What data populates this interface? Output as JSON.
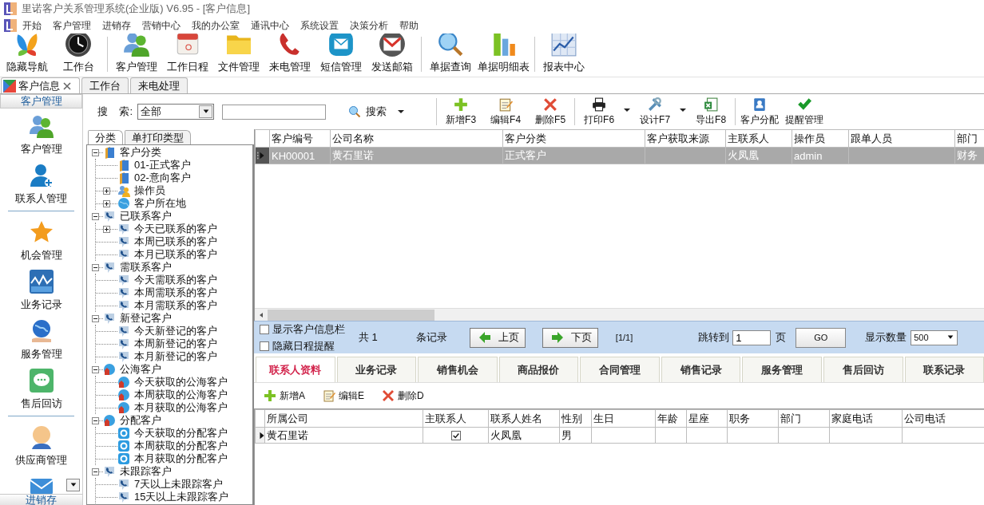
{
  "window": {
    "title": "里诺客户关系管理系统(企业版) V6.95 - [客户信息]"
  },
  "menu": [
    "开始",
    "客户管理",
    "进销存",
    "营销中心",
    "我的办公室",
    "通讯中心",
    "系统设置",
    "决策分析",
    "帮助"
  ],
  "toolbar": [
    [
      "隐藏导航",
      "工作台"
    ],
    [
      "客户管理",
      "工作日程",
      "文件管理",
      "来电管理",
      "短信管理",
      "发送邮箱"
    ],
    [
      "单据查询",
      "单据明细表"
    ],
    [
      "报表中心"
    ]
  ],
  "doc_tabs": [
    {
      "label": "客户信息",
      "selected": true,
      "closable": true
    },
    {
      "label": "工作台",
      "selected": false,
      "closable": false
    },
    {
      "label": "来电处理",
      "selected": false,
      "closable": false
    }
  ],
  "nav": {
    "header": "客户管理",
    "groups": [
      [
        "客户管理",
        "联系人管理"
      ],
      [
        "机会管理",
        "业务记录",
        "服务管理",
        "售后回访"
      ],
      [
        "供应商管理"
      ]
    ],
    "footer": "进销存"
  },
  "search": {
    "label": "搜    索:",
    "scope": "全部",
    "button": "搜索"
  },
  "actions": [
    [
      {
        "label": "新增F3",
        "dropdown": false
      },
      {
        "label": "编辑F4",
        "dropdown": false
      },
      {
        "label": "删除F5",
        "dropdown": false
      }
    ],
    [
      {
        "label": "打印F6",
        "dropdown": true
      },
      {
        "label": "设计F7",
        "dropdown": true
      },
      {
        "label": "导出F8",
        "dropdown": false
      }
    ],
    [
      {
        "label": "客户分配",
        "dropdown": false
      },
      {
        "label": "提醒管理",
        "dropdown": false
      }
    ]
  ],
  "tree_tabs": [
    {
      "label": "分类",
      "selected": true
    },
    {
      "label": "单打印类型",
      "selected": false
    }
  ],
  "tree": [
    {
      "label": "客户分类",
      "kind": "book",
      "expanded": true,
      "children": [
        {
          "label": "01-正式客户",
          "kind": "book"
        },
        {
          "label": "02-意向客户",
          "kind": "book"
        },
        {
          "label": "操作员",
          "kind": "users",
          "expanded": false
        },
        {
          "label": "客户所在地",
          "kind": "globe",
          "expanded": false
        }
      ]
    },
    {
      "label": "已联系客户",
      "kind": "phone",
      "expanded": true,
      "children": [
        {
          "label": "今天已联系的客户",
          "kind": "phone",
          "expanded": false
        },
        {
          "label": "本周已联系的客户",
          "kind": "phone"
        },
        {
          "label": "本月已联系的客户",
          "kind": "phone"
        }
      ]
    },
    {
      "label": "需联系客户",
      "kind": "phone",
      "expanded": true,
      "children": [
        {
          "label": "今天需联系的客户",
          "kind": "phone"
        },
        {
          "label": "本周需联系的客户",
          "kind": "phone"
        },
        {
          "label": "本月需联系的客户",
          "kind": "phone"
        }
      ]
    },
    {
      "label": "新登记客户",
      "kind": "phone",
      "expanded": true,
      "children": [
        {
          "label": "今天新登记的客户",
          "kind": "phone"
        },
        {
          "label": "本周新登记的客户",
          "kind": "phone"
        },
        {
          "label": "本月新登记的客户",
          "kind": "phone"
        }
      ]
    },
    {
      "label": "公海客户",
      "kind": "sea",
      "expanded": true,
      "children": [
        {
          "label": "今天获取的公海客户",
          "kind": "sea"
        },
        {
          "label": "本周获取的公海客户",
          "kind": "sea"
        },
        {
          "label": "本月获取的公海客户",
          "kind": "sea"
        }
      ]
    },
    {
      "label": "分配客户",
      "kind": "sea",
      "expanded": true,
      "children": [
        {
          "label": "今天获取的分配客户",
          "kind": "badge"
        },
        {
          "label": "本周获取的分配客户",
          "kind": "badge"
        },
        {
          "label": "本月获取的分配客户",
          "kind": "badge"
        }
      ]
    },
    {
      "label": "未跟踪客户",
      "kind": "phone",
      "expanded": true,
      "children": [
        {
          "label": "7天以上未跟踪客户",
          "kind": "phone"
        },
        {
          "label": "15天以上未跟踪客户",
          "kind": "phone"
        }
      ]
    }
  ],
  "grid": {
    "columns": [
      "客户编号",
      "公司名称",
      "客户分类",
      "客户获取来源",
      "主联系人",
      "操作员",
      "跟单人员",
      "部门"
    ],
    "rows": [
      {
        "selected": true,
        "cells": [
          "KH00001",
          "黄石里诺",
          "正式客户",
          null,
          "火凤凰",
          "admin",
          null,
          "财务"
        ]
      }
    ]
  },
  "pager": {
    "options": [
      {
        "label": "显示客户信息栏",
        "checked": false
      },
      {
        "label": "隐藏日程提醒",
        "checked": false
      }
    ],
    "total": "共 1",
    "total_unit": "条记录",
    "prev": "上页",
    "next": "下页",
    "page_info": "[1/1]",
    "jump_label": "跳转到",
    "jump_value": "1",
    "jump_unit": "页",
    "go": "GO",
    "size_label": "显示数量",
    "size_value": "500"
  },
  "detail_tabs": [
    {
      "label": "联系人资料",
      "selected": true
    },
    {
      "label": "业务记录",
      "selected": false
    },
    {
      "label": "销售机会",
      "selected": false
    },
    {
      "label": "商品报价",
      "selected": false
    },
    {
      "label": "合同管理",
      "selected": false
    },
    {
      "label": "销售记录",
      "selected": false
    },
    {
      "label": "服务管理",
      "selected": false
    },
    {
      "label": "售后回访",
      "selected": false
    },
    {
      "label": "联系记录",
      "selected": false
    }
  ],
  "detail_actions": [
    "新增A",
    "编辑E",
    "删除D"
  ],
  "contacts": {
    "columns": [
      "所属公司",
      "主联系人",
      "联系人姓名",
      "性别",
      "生日",
      "年龄",
      "星座",
      "职务",
      "部门",
      "家庭电话",
      "公司电话"
    ],
    "rows": [
      {
        "selected": true,
        "primary": true,
        "cells": [
          "黄石里诺",
          null,
          "火凤凰",
          "男",
          null,
          null,
          null,
          null,
          null,
          null,
          null
        ]
      }
    ]
  }
}
